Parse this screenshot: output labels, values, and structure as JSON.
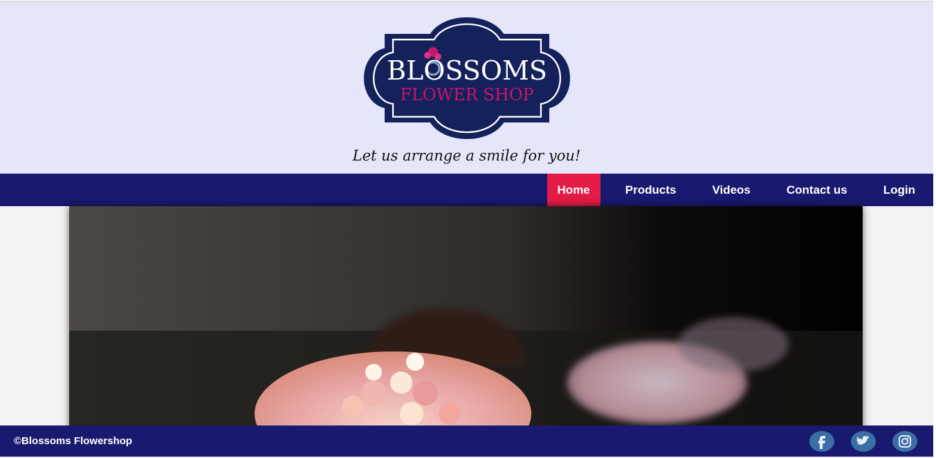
{
  "brand": {
    "name_top": "BLOSSOMS",
    "name_bottom": "FLOWER SHOP",
    "tagline": "Let us arrange a smile for you!"
  },
  "nav": {
    "items": [
      "Home",
      "Products",
      "Videos",
      "Contact us",
      "Login"
    ],
    "active": "Home"
  },
  "hero": {
    "image": "flower-bouquet-table-photo"
  },
  "footer": {
    "copyright": "©Blossoms Flowershop",
    "social": [
      "facebook-icon",
      "twitter-icon",
      "instagram-icon"
    ]
  },
  "colors": {
    "header_bg": "#e5e6fa",
    "nav_bg": "#191970",
    "active_tab": "#e31b45",
    "logo_navy": "#14215a",
    "logo_pink": "#c2186b",
    "social_blue": "#3a6ea5"
  }
}
